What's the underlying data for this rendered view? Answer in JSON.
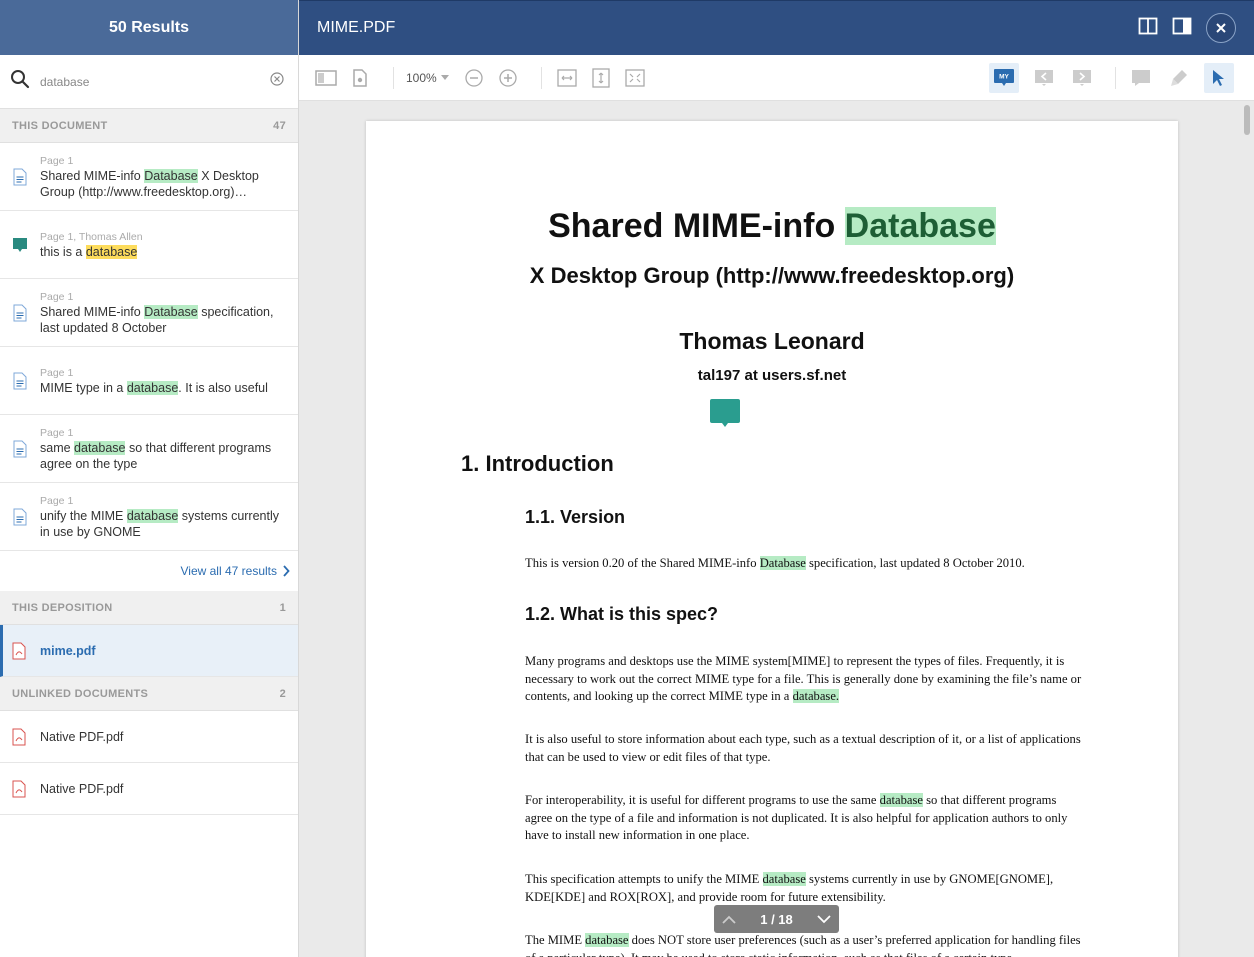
{
  "sidebar": {
    "results_title": "50 Results",
    "search_value": "database",
    "this_document": {
      "label": "THIS DOCUMENT",
      "count": "47"
    },
    "results": [
      {
        "page": "Page 1",
        "pre": "Shared MIME-info ",
        "match": "Database",
        "post": " X Desktop Group (http://www.freedesktop.org)…",
        "kind": "doc"
      },
      {
        "page": "Page 1, Thomas Allen",
        "pre": "this is a ",
        "match": "database",
        "post": "",
        "kind": "comment"
      },
      {
        "page": "Page 1",
        "pre": "Shared MIME-info ",
        "match": "Database",
        "post": " specification, last updated 8 October",
        "kind": "doc"
      },
      {
        "page": "Page 1",
        "pre": "MIME type in a ",
        "match": "database",
        "post": ". It is also useful",
        "kind": "doc"
      },
      {
        "page": "Page 1",
        "pre": "same ",
        "match": "database",
        "post": " so that different programs agree on the type",
        "kind": "doc"
      },
      {
        "page": "Page 1",
        "pre": "unify the MIME ",
        "match": "database",
        "post": " systems currently in use by GNOME",
        "kind": "doc"
      }
    ],
    "view_all": "View all 47 results",
    "this_deposition": {
      "label": "THIS DEPOSITION",
      "count": "1"
    },
    "deposition_file": "mime.pdf",
    "unlinked": {
      "label": "UNLINKED DOCUMENTS",
      "count": "2"
    },
    "unlinked_files": [
      "Native PDF.pdf",
      "Native PDF.pdf"
    ]
  },
  "header": {
    "title": "MIME.PDF"
  },
  "toolbar": {
    "zoom": "100%",
    "my_label": "MY"
  },
  "document": {
    "title_pre": "Shared MIME-info ",
    "title_match": "Database",
    "subtitle": "X Desktop Group  (http://www.freedesktop.org)",
    "author": "Thomas Leonard",
    "email": "tal197 at users.sf.net",
    "h1": "1. Introduction",
    "h2a": "1.1. Version",
    "h2b": "1.2. What is this spec?",
    "p1_pre": "This is version 0.20 of the Shared MIME-info ",
    "p1_match": "Database",
    "p1_post": " specification, last updated 8 October 2010.",
    "p2_pre": "Many programs and desktops use the MIME system[MIME] to represent the types of files. Frequently, it is necessary to work out the correct MIME type for a file. This is generally done by examining the file’s name or contents, and looking up the correct MIME type in a ",
    "p2_match": "database.",
    "p3": "It is also useful to store information about each type, such as a textual description of it, or a list of applications that can be used to view or edit files of that type.",
    "p4_pre": "For interoperability, it is useful for different programs to use the same ",
    "p4_match": "database",
    "p4_post": " so that different programs agree on the type of a file and information is not duplicated. It is also helpful for application authors to only have to install new information in one place.",
    "p5_pre": "This specification attempts to unify the MIME ",
    "p5_match": "database",
    "p5_post": " systems currently in use by GNOME[GNOME], KDE[KDE] and ROX[ROX], and provide room for future extensibility.",
    "p6_pre": "The MIME ",
    "p6_match": "database",
    "p6_post": " does NOT store user preferences (such as a user’s preferred application for handling files of a particular type). It may be used to store static information, such as that files of a certain type"
  },
  "pager": {
    "label": "1 / 18"
  },
  "colors": {
    "header": "#2f4f82",
    "sidebar_header": "#4a6a99",
    "highlight": "#b6ebc4",
    "accent": "#2b6cb0"
  }
}
